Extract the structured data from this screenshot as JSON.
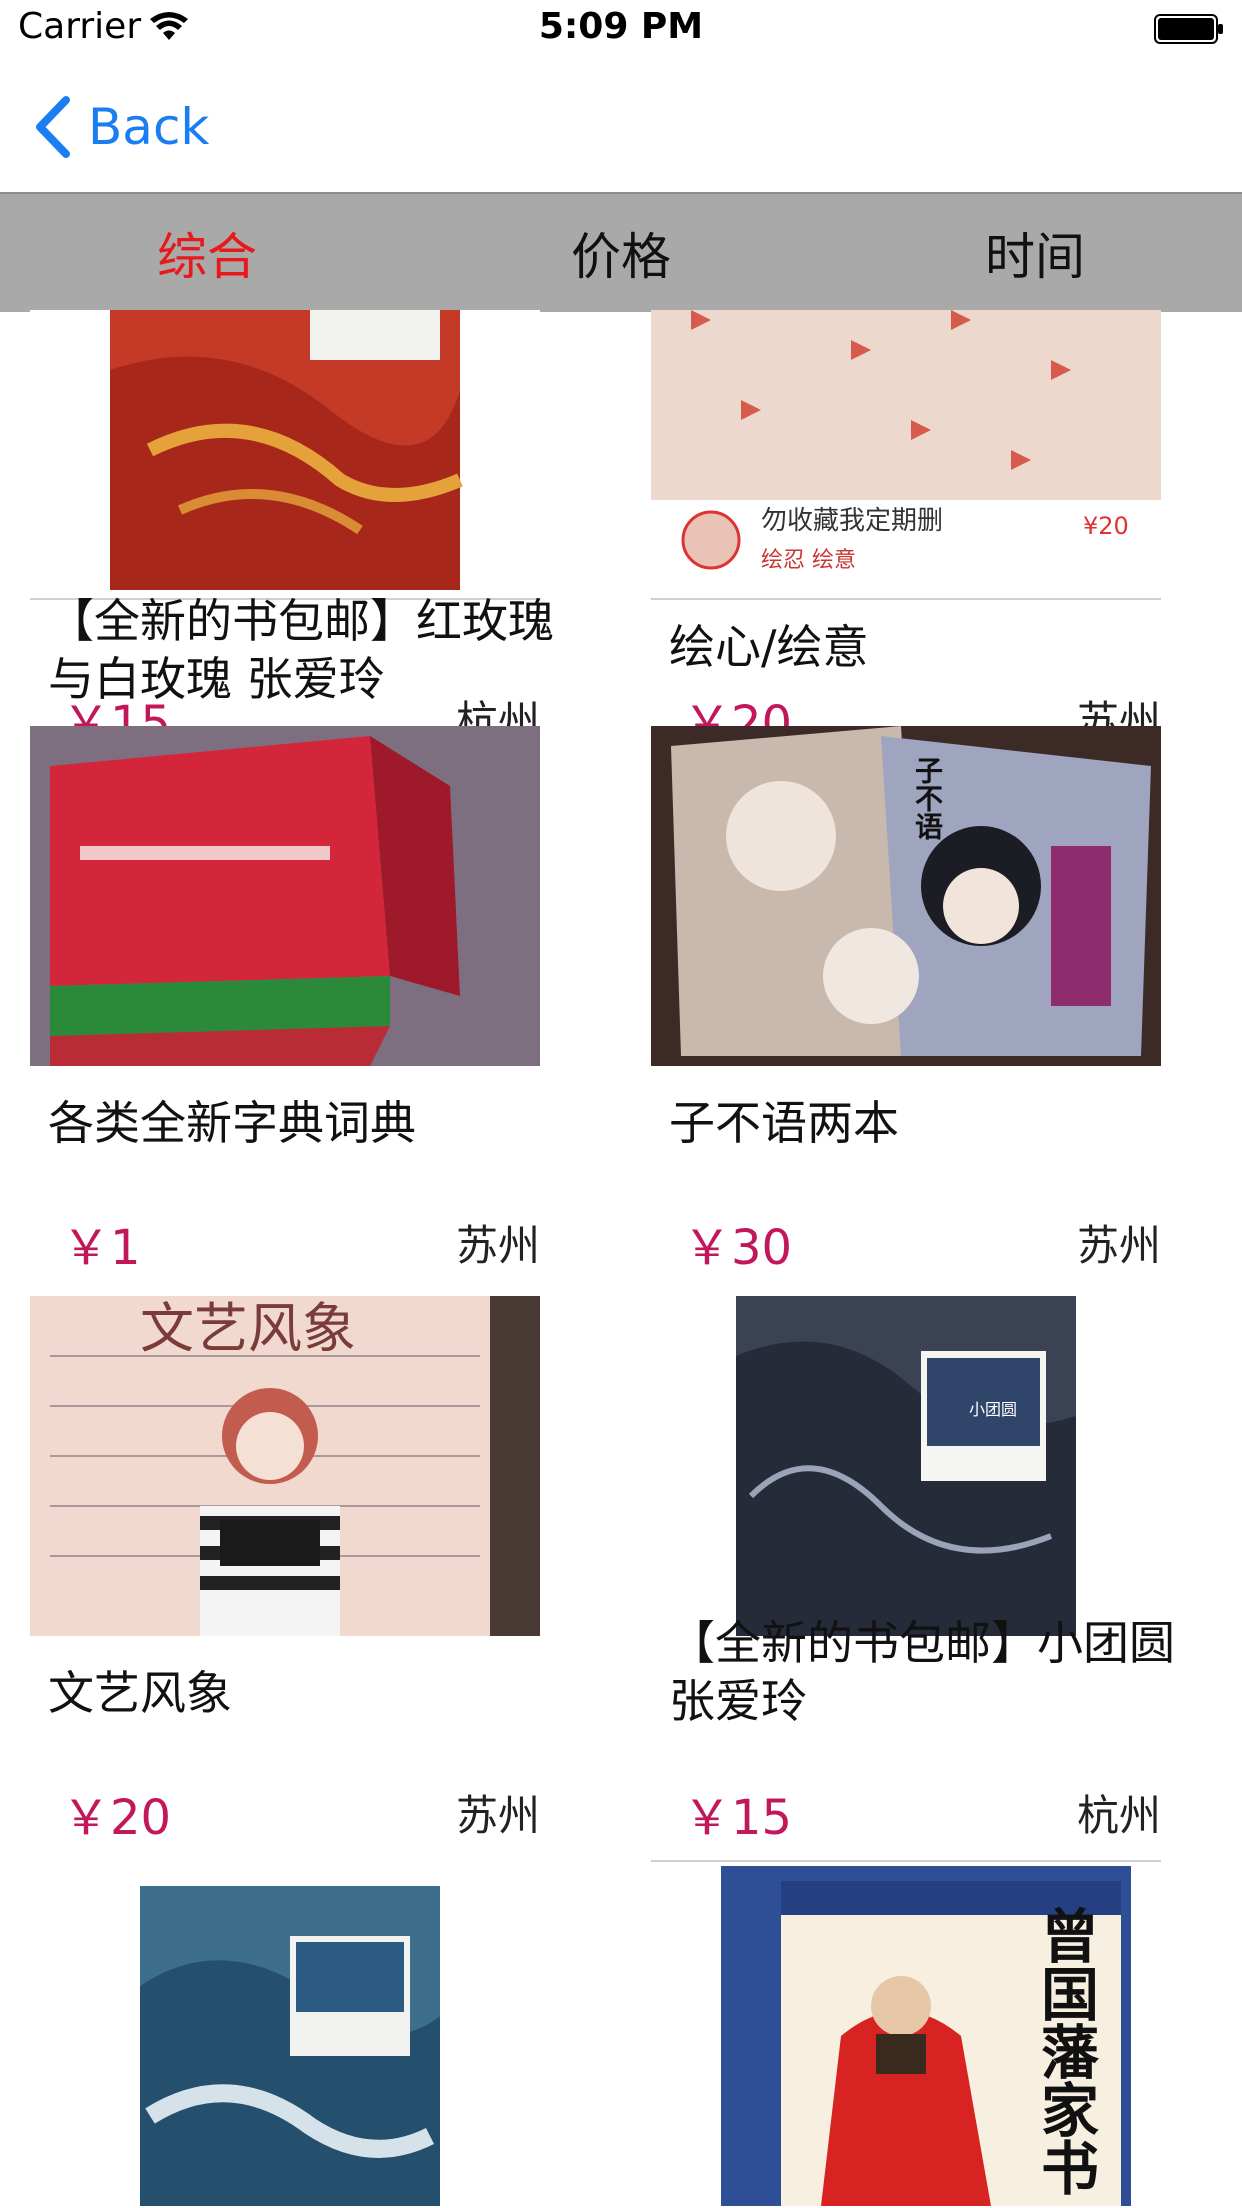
{
  "status_bar": {
    "carrier": "Carrier",
    "time": "5:09 PM"
  },
  "nav": {
    "back_label": "Back"
  },
  "segments": [
    "综合",
    "价格",
    "时间"
  ],
  "active_segment": 0,
  "colors": {
    "accent_red": "#e8191b",
    "price": "#c2185b",
    "link_blue": "#1a7ef2",
    "segbar_bg": "#a9a9a9"
  },
  "products": [
    {
      "title": "【全新的书包邮】红玫瑰与白玫瑰 张爱玲",
      "price": "￥15",
      "city": "杭州"
    },
    {
      "title": "绘心/绘意",
      "price": "￥20",
      "city": "苏州",
      "cover_text": [
        "勿收藏我定期删",
        "绘忍 绘意",
        "¥20"
      ]
    },
    {
      "title": "各类全新字典词典",
      "price": "￥1",
      "city": "苏州"
    },
    {
      "title": "子不语两本",
      "price": "￥30",
      "city": "苏州",
      "cover_text": [
        "子不语"
      ]
    },
    {
      "title": "文艺风象",
      "price": "￥20",
      "city": "苏州",
      "cover_text": [
        "文艺风象"
      ]
    },
    {
      "title": "【全新的书包邮】小团圆 张爱玲",
      "price": "￥15",
      "city": "杭州",
      "cover_text": [
        "小团圆"
      ]
    },
    {
      "title": "",
      "price": "",
      "city": ""
    },
    {
      "title": "",
      "price": "",
      "city": "",
      "cover_text": [
        "曾国藩家书"
      ]
    }
  ]
}
